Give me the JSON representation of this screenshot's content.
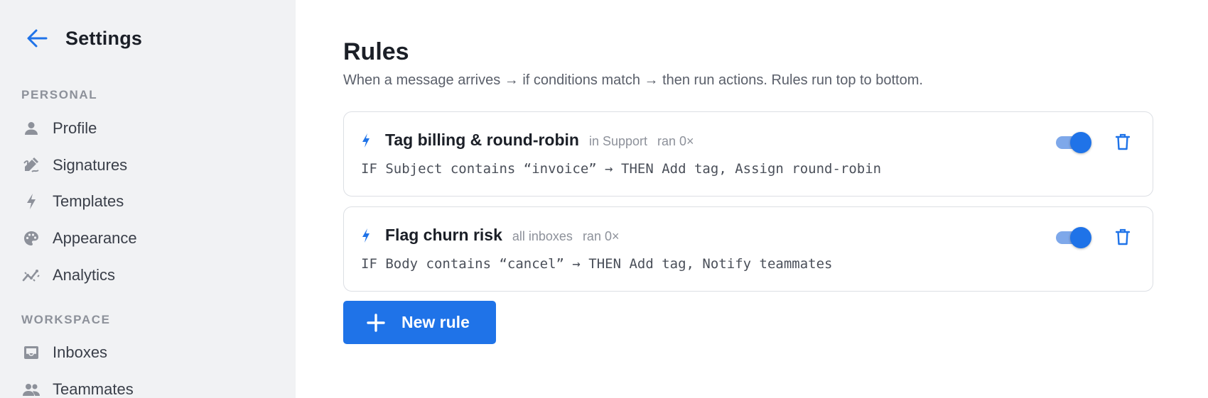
{
  "sidebar": {
    "title": "Settings",
    "sections": [
      {
        "label": "PERSONAL",
        "items": [
          {
            "label": "Profile",
            "icon": "person-icon"
          },
          {
            "label": "Signatures",
            "icon": "signature-icon"
          },
          {
            "label": "Templates",
            "icon": "bolt-icon"
          },
          {
            "label": "Appearance",
            "icon": "palette-icon"
          },
          {
            "label": "Analytics",
            "icon": "analytics-icon"
          }
        ]
      },
      {
        "label": "WORKSPACE",
        "items": [
          {
            "label": "Inboxes",
            "icon": "inbox-icon"
          },
          {
            "label": "Teammates",
            "icon": "people-icon"
          }
        ]
      }
    ]
  },
  "main": {
    "title": "Rules",
    "subtitle": "When a message arrives → if conditions match → then run actions. Rules run top to bottom.",
    "rules": [
      {
        "name": "Tag billing & round-robin",
        "scope": "in Support",
        "ran": "ran 0×",
        "logic": "IF Subject contains “invoice” → THEN Add tag, Assign round-robin",
        "enabled": true
      },
      {
        "name": "Flag churn risk",
        "scope": "all inboxes",
        "ran": "ran 0×",
        "logic": "IF Body contains “cancel” → THEN Add tag, Notify teammates",
        "enabled": true
      }
    ],
    "new_rule_label": "New rule"
  },
  "colors": {
    "accent": "#1f73e8",
    "sidebar_bg": "#f1f2f4",
    "muted_text": "#8d919a"
  }
}
